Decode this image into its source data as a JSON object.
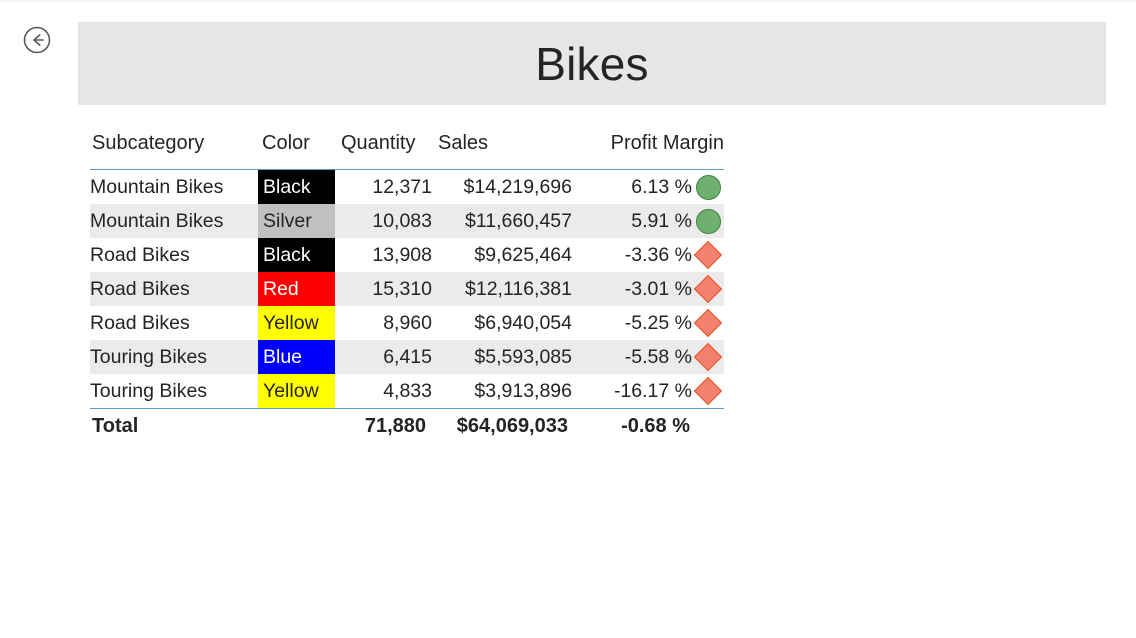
{
  "page": {
    "title": "Bikes",
    "back_icon": "back-arrow-circle-icon",
    "banner_color": "#e6e6e6",
    "accent_rule_color": "#5a9bd5"
  },
  "table": {
    "columns": [
      {
        "key": "subcategory",
        "label": "Subcategory"
      },
      {
        "key": "color",
        "label": "Color"
      },
      {
        "key": "quantity",
        "label": "Quantity"
      },
      {
        "key": "sales",
        "label": "Sales"
      },
      {
        "key": "margin",
        "label": "Profit Margin"
      }
    ],
    "rows": [
      {
        "subcategory": "Mountain Bikes",
        "color": "Black",
        "color_bg": "#000000",
        "color_fg": "#ffffff",
        "quantity": "12,371",
        "sales": "$14,219,696",
        "margin": "6.13 %",
        "kpi": "circle-green"
      },
      {
        "subcategory": "Mountain Bikes",
        "color": "Silver",
        "color_bg": "#c0c0c0",
        "color_fg": "#252423",
        "quantity": "10,083",
        "sales": "$11,660,457",
        "margin": "5.91 %",
        "kpi": "circle-green"
      },
      {
        "subcategory": "Road Bikes",
        "color": "Black",
        "color_bg": "#000000",
        "color_fg": "#ffffff",
        "quantity": "13,908",
        "sales": "$9,625,464",
        "margin": "-3.36 %",
        "kpi": "diamond-red"
      },
      {
        "subcategory": "Road Bikes",
        "color": "Red",
        "color_bg": "#ff0000",
        "color_fg": "#ffffff",
        "quantity": "15,310",
        "sales": "$12,116,381",
        "margin": "-3.01 %",
        "kpi": "diamond-red"
      },
      {
        "subcategory": "Road Bikes",
        "color": "Yellow",
        "color_bg": "#ffff00",
        "color_fg": "#252423",
        "quantity": "8,960",
        "sales": "$6,940,054",
        "margin": "-5.25 %",
        "kpi": "diamond-red"
      },
      {
        "subcategory": "Touring Bikes",
        "color": "Blue",
        "color_bg": "#0000ff",
        "color_fg": "#ffffff",
        "quantity": "6,415",
        "sales": "$5,593,085",
        "margin": "-5.58 %",
        "kpi": "diamond-red"
      },
      {
        "subcategory": "Touring Bikes",
        "color": "Yellow",
        "color_bg": "#ffff00",
        "color_fg": "#252423",
        "quantity": "4,833",
        "sales": "$3,913,896",
        "margin": "-16.17 %",
        "kpi": "diamond-red"
      }
    ],
    "total": {
      "subcategory": "Total",
      "color": "",
      "quantity": "71,880",
      "sales": "$64,069,033",
      "margin": "-0.68 %",
      "kpi": ""
    }
  }
}
